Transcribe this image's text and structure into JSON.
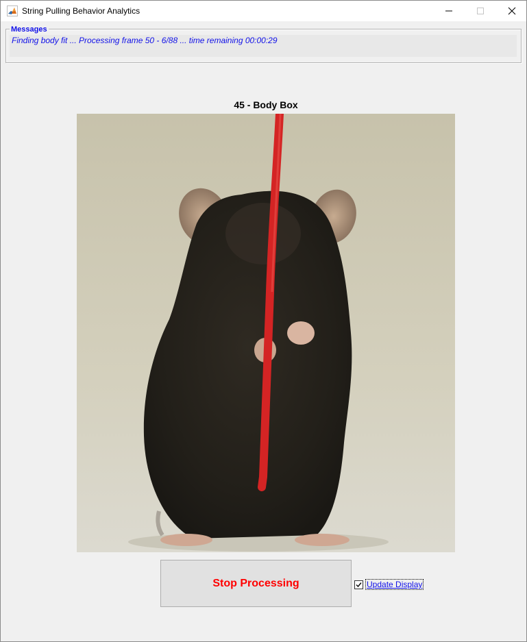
{
  "window": {
    "title": "String Pulling Behavior Analytics",
    "app_icon": "matlab-icon"
  },
  "messages": {
    "legend": "Messages",
    "text": "Finding body fit ... Processing frame 50 - 6/88 ... time remaining 00:00:29"
  },
  "axes": {
    "title": "45 - Body Box",
    "image": "photo of a dark mouse standing upright holding a red string"
  },
  "controls": {
    "stop_label": "Stop Processing",
    "update_display_label": "Update Display",
    "update_display_checked": true
  },
  "colors": {
    "message_blue": "#1010e8",
    "stop_red": "#ff0000"
  }
}
